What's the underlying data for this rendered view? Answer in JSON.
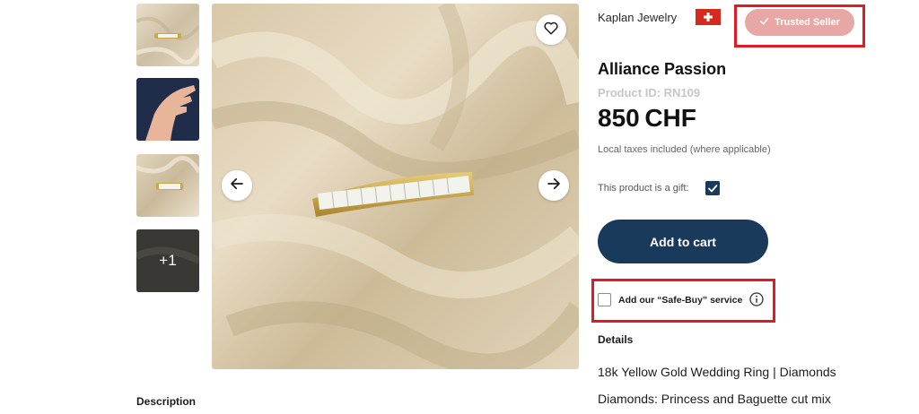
{
  "gallery": {
    "thumbnails": [
      {
        "name": "ring-on-satin"
      },
      {
        "name": "ring-on-hand"
      },
      {
        "name": "ring-closeup"
      },
      {
        "name": "more-images",
        "overlay_label": "+1"
      }
    ],
    "prev_icon": "arrow-left-icon",
    "next_icon": "arrow-right-icon",
    "favorite_icon": "heart-icon"
  },
  "seller": {
    "name": "Kaplan Jewelry",
    "country_flag": "swiss-flag",
    "badge_label": "Trusted Seller",
    "badge_icon": "check-icon"
  },
  "product": {
    "title": "Alliance Passion",
    "id_label": "Product ID: RN109",
    "price": "850 CHF",
    "tax_note": "Local taxes included (where applicable)",
    "gift_label": "This product is a gift:",
    "gift_checked": true
  },
  "actions": {
    "add_to_cart": "Add to cart",
    "safe_buy_label": "Add our “Safe-Buy” service",
    "safe_buy_checked": false
  },
  "details": {
    "heading": "Details",
    "line1": "18k Yellow Gold Wedding Ring | Diamonds",
    "line2": "Diamonds: Princess and Baguette cut mix"
  },
  "description": {
    "heading": "Description"
  },
  "colors": {
    "primary": "#1a3a5c",
    "highlight": "#e01b24",
    "badge": "#e7a7a4",
    "flag": "#d52b1e"
  }
}
